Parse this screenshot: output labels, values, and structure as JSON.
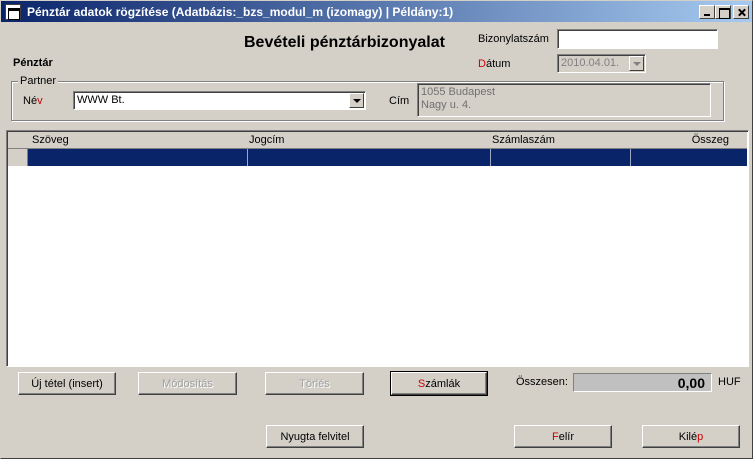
{
  "window": {
    "title": "Pénztár adatok rögzítése  (Adatbázis:_bzs_modul_m (izomagy) | Példány:1)"
  },
  "form": {
    "heading": "Bevételi pénztárbizonyalat",
    "section_label": "Pénztár",
    "bizonylatszam": {
      "label": "Bizonylatszám",
      "value": ""
    },
    "datum": {
      "label_first": "D",
      "label_rest": "átum",
      "value": "2010.04.01."
    },
    "partner": {
      "group_label": "Partner",
      "nev": {
        "label_first": "Né",
        "label_rest": "v",
        "value": "WWW Bt."
      },
      "cim": {
        "label": "Cím",
        "value": "1055 Budapest\nNagy u. 4."
      }
    }
  },
  "grid": {
    "columns": [
      "Szöveg",
      "Jogcím",
      "Számlaszám",
      "Összeg"
    ],
    "rows": [
      {
        "szoveg": "",
        "jogcim": "",
        "szamlaszam": "",
        "osszeg": ""
      }
    ]
  },
  "buttons": {
    "uj_tetel": "Új tétel (insert)",
    "modositas": "Módosítás",
    "torles": "Törlés",
    "szamlak": {
      "first": "S",
      "rest": "zámlák"
    },
    "nyugta": "Nyugta felvitel",
    "felir": {
      "first": "F",
      "rest": "elír"
    },
    "kilep": {
      "first": "Kilé",
      "accel": "p"
    }
  },
  "totals": {
    "label": "Összesen:",
    "value": "0,00",
    "currency": "HUF"
  },
  "colors": {
    "title_start": "#0a246a",
    "title_end": "#a6caf0",
    "selection": "#0a246a",
    "accelerator": "#cc0000"
  }
}
